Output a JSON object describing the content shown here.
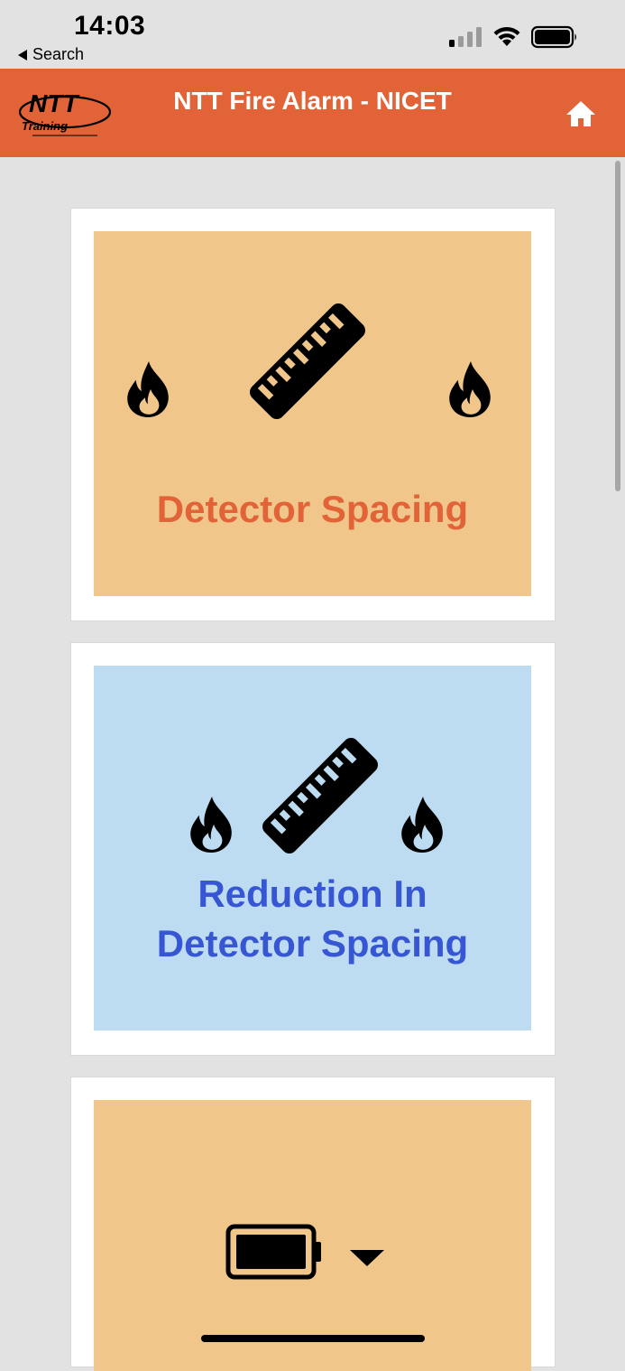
{
  "status_bar": {
    "time": "14:03",
    "back_label": "Search"
  },
  "header": {
    "logo_text": "NTT Training",
    "title": "NTT Fire Alarm - NICET",
    "home_icon": "home-icon"
  },
  "cards": [
    {
      "label": "Detector Spacing",
      "icons": [
        "flame-icon",
        "ruler-icon",
        "flame-icon"
      ],
      "color": "#f1c68b",
      "label_color": "#e16337"
    },
    {
      "label_line1": "Reduction In",
      "label_line2": "Detector Spacing",
      "icons": [
        "flame-icon",
        "ruler-icon",
        "flame-icon"
      ],
      "color": "#bddcf2",
      "label_color": "#3756d4"
    },
    {
      "icons": [
        "battery-icon",
        "caret-down-icon"
      ],
      "color": "#f1c68b"
    }
  ],
  "colors": {
    "header": "#e16337",
    "background": "#e2e2e2"
  }
}
